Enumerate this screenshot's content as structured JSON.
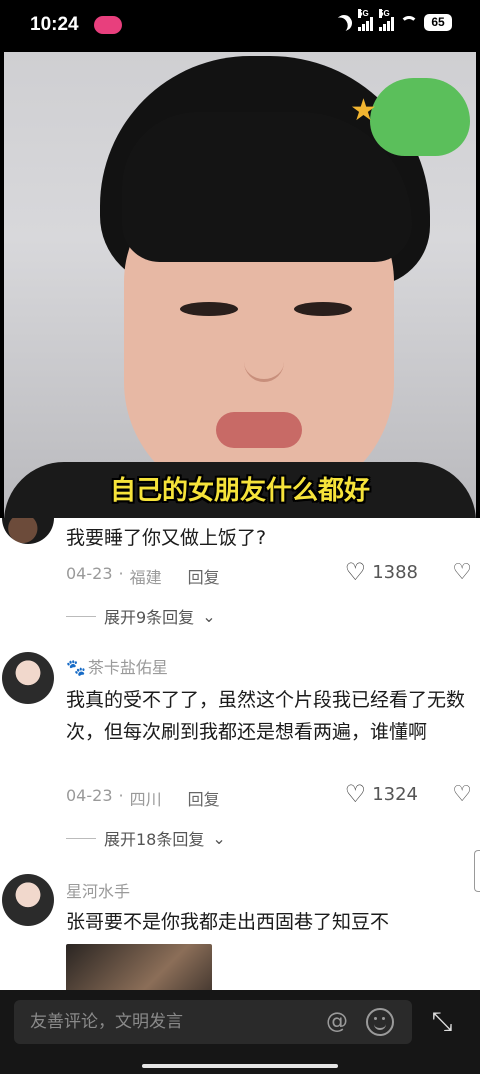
{
  "status_bar": {
    "time": "10:24",
    "network_1": "5G",
    "network_2": "5G",
    "battery": "65"
  },
  "video": {
    "caption": "自己的女朋友什么都好"
  },
  "comments": [
    {
      "username": "",
      "text": "我要睡了你又做上饭了?",
      "date": "04-23",
      "location": "福建",
      "reply_label": "回复",
      "likes": "1388",
      "expand_label": "展开9条回复"
    },
    {
      "username": "茶卡盐佑星",
      "text": "我真的受不了了，虽然这个片段我已经看了无数次，但每次刷到我都还是想看两遍，谁懂啊",
      "date": "04-23",
      "location": "四川",
      "reply_label": "回复",
      "likes": "1324",
      "expand_label": "展开18条回复"
    },
    {
      "username": "星河水手",
      "text": "张哥要不是你我都走出西固巷了知豆不"
    }
  ],
  "input": {
    "placeholder": "友善评论，文明发言"
  },
  "icons": {
    "at": "at-icon",
    "emoji": "emoji-icon",
    "collapse": "collapse-icon",
    "like": "heart-icon",
    "dislike": "broken-heart-icon"
  }
}
